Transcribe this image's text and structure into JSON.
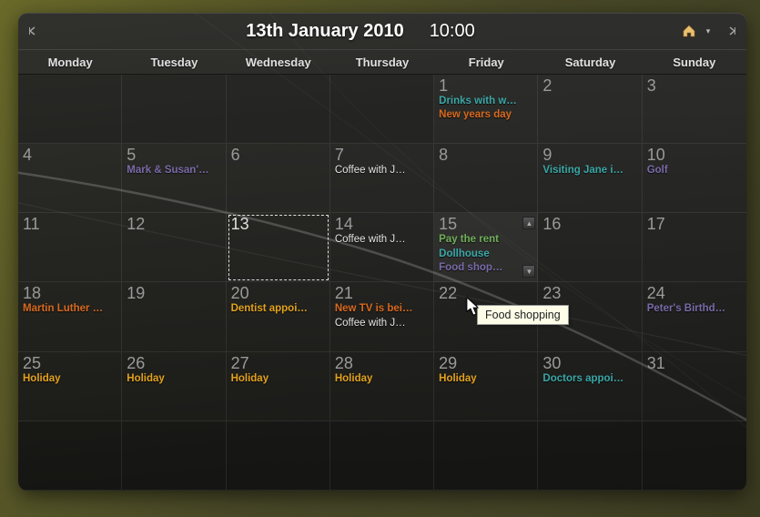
{
  "header": {
    "date_label": "13th January 2010",
    "time_label": "10:00"
  },
  "days_of_week": [
    "Monday",
    "Tuesday",
    "Wednesday",
    "Thursday",
    "Friday",
    "Saturday",
    "Sunday"
  ],
  "tooltip": "Food shopping",
  "colors": {
    "teal": "#3aa7a7",
    "orange": "#d8691e",
    "purple": "#7a6aa8",
    "white": "#e5e5e5",
    "green": "#6fb05a",
    "yellow": "#e3a21e"
  },
  "weeks": [
    [
      {
        "empty": true
      },
      {
        "empty": true
      },
      {
        "empty": true
      },
      {
        "empty": true
      },
      {
        "num": "1",
        "events": [
          {
            "text": "Drinks with w…",
            "color": "teal"
          },
          {
            "text": "New years day",
            "color": "orange"
          }
        ]
      },
      {
        "num": "2"
      },
      {
        "num": "3"
      }
    ],
    [
      {
        "num": "4"
      },
      {
        "num": "5",
        "events": [
          {
            "text": "Mark & Susan'…",
            "color": "purple"
          }
        ]
      },
      {
        "num": "6"
      },
      {
        "num": "7",
        "events": [
          {
            "text": "Coffee with J…",
            "color": "white"
          }
        ]
      },
      {
        "num": "8"
      },
      {
        "num": "9",
        "events": [
          {
            "text": "Visiting Jane i…",
            "color": "teal"
          }
        ]
      },
      {
        "num": "10",
        "events": [
          {
            "text": "Golf",
            "color": "purple"
          }
        ]
      }
    ],
    [
      {
        "num": "11"
      },
      {
        "num": "12"
      },
      {
        "num": "13",
        "today": true
      },
      {
        "num": "14",
        "events": [
          {
            "text": "Coffee with J…",
            "color": "white"
          }
        ]
      },
      {
        "num": "15",
        "fifteen": true,
        "overflow": true,
        "events": [
          {
            "text": "Pay the rent",
            "color": "green"
          },
          {
            "text": "Dollhouse",
            "color": "teal"
          },
          {
            "text": "Food shop…",
            "color": "purple"
          }
        ]
      },
      {
        "num": "16"
      },
      {
        "num": "17"
      }
    ],
    [
      {
        "num": "18",
        "events": [
          {
            "text": "Martin Luther …",
            "color": "orange"
          }
        ]
      },
      {
        "num": "19"
      },
      {
        "num": "20",
        "events": [
          {
            "text": "Dentist appoi…",
            "color": "yellow"
          }
        ]
      },
      {
        "num": "21",
        "events": [
          {
            "text": "New TV is bei…",
            "color": "orange"
          },
          {
            "text": "Coffee with J…",
            "color": "white"
          }
        ]
      },
      {
        "num": "22"
      },
      {
        "num": "23"
      },
      {
        "num": "24",
        "events": [
          {
            "text": "Peter's Birthd…",
            "color": "purple"
          }
        ]
      }
    ],
    [
      {
        "num": "25",
        "events": [
          {
            "text": "Holiday",
            "color": "yellow"
          }
        ]
      },
      {
        "num": "26",
        "events": [
          {
            "text": "Holiday",
            "color": "yellow"
          }
        ]
      },
      {
        "num": "27",
        "events": [
          {
            "text": "Holiday",
            "color": "yellow"
          }
        ]
      },
      {
        "num": "28",
        "events": [
          {
            "text": "Holiday",
            "color": "yellow"
          }
        ]
      },
      {
        "num": "29",
        "events": [
          {
            "text": "Holiday",
            "color": "yellow"
          }
        ]
      },
      {
        "num": "30",
        "events": [
          {
            "text": "Doctors appoi…",
            "color": "teal"
          }
        ]
      },
      {
        "num": "31"
      }
    ],
    [
      {
        "empty": true
      },
      {
        "empty": true
      },
      {
        "empty": true
      },
      {
        "empty": true
      },
      {
        "empty": true
      },
      {
        "empty": true
      },
      {
        "empty": true
      }
    ]
  ]
}
